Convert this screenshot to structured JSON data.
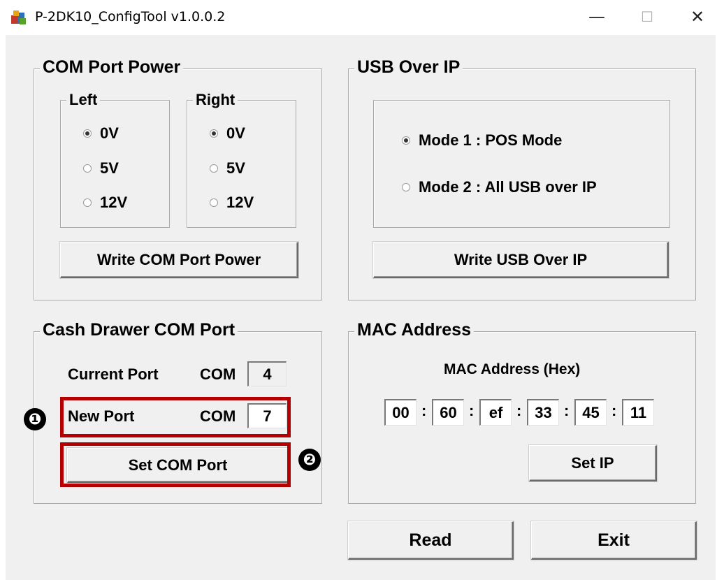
{
  "window": {
    "title": "P-2DK10_ConfigTool v1.0.0.2",
    "minimize": "—",
    "maximize": "☐",
    "close": "✕"
  },
  "com_power": {
    "title": "COM Port Power",
    "left": {
      "title": "Left",
      "options": [
        "0V",
        "5V",
        "12V"
      ],
      "selected": "0V"
    },
    "right": {
      "title": "Right",
      "options": [
        "0V",
        "5V",
        "12V"
      ],
      "selected": "0V"
    },
    "write_button": "Write COM Port Power"
  },
  "usb_over_ip": {
    "title": "USB Over IP",
    "options": [
      "Mode 1 : POS Mode",
      "Mode 2 : All USB over IP"
    ],
    "selected": "Mode 1 : POS Mode",
    "write_button": "Write USB Over IP"
  },
  "cash_drawer": {
    "title": "Cash Drawer COM Port",
    "current_port_label": "Current Port",
    "current_prefix": "COM",
    "current_value": "4",
    "new_port_label": "New Port",
    "new_prefix": "COM",
    "new_value": "7",
    "set_button": "Set COM Port"
  },
  "mac": {
    "title": "MAC Address",
    "subtitle": "MAC Address (Hex)",
    "octets": [
      "00",
      "60",
      "ef",
      "33",
      "45",
      "11"
    ],
    "separator": ":",
    "set_button": "Set IP"
  },
  "footer": {
    "read_button": "Read",
    "exit_button": "Exit"
  },
  "annotations": {
    "step1": "❶",
    "step2": "❷",
    "highlight_color": "#b40000"
  }
}
